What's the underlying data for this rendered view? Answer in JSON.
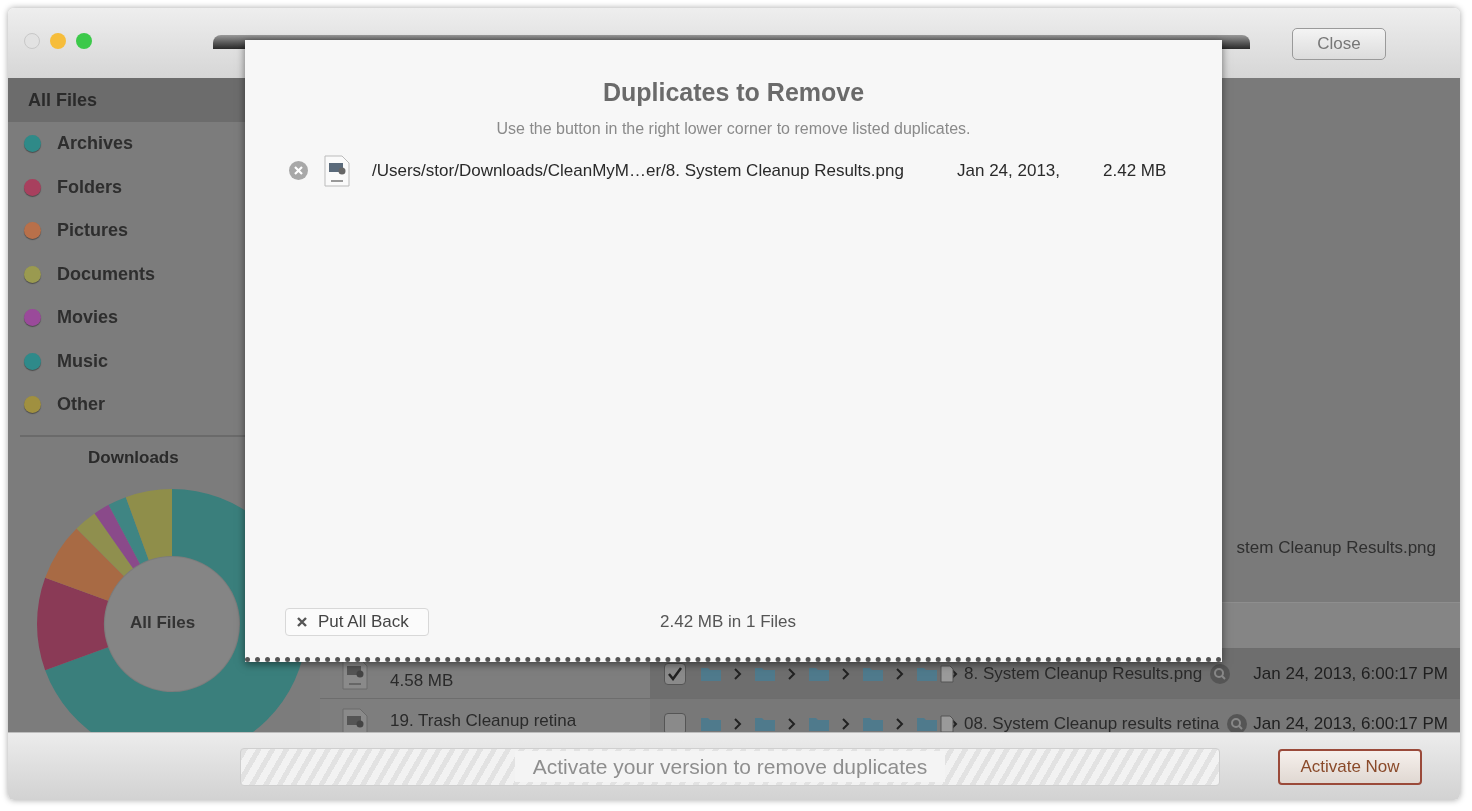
{
  "window": {
    "close_button": "Close"
  },
  "sidebar": {
    "header": "All Files",
    "items": [
      {
        "label": "Archives",
        "color": "#2f8a88"
      },
      {
        "label": "Folders",
        "color": "#a8405e"
      },
      {
        "label": "Pictures",
        "color": "#b8704a"
      },
      {
        "label": "Documents",
        "color": "#9a9a50"
      },
      {
        "label": "Movies",
        "color": "#9a4a9a"
      },
      {
        "label": "Music",
        "color": "#2f8a8a"
      },
      {
        "label": "Other",
        "color": "#a09040"
      }
    ],
    "chart_title": "Downloads",
    "chart_center": "All Files"
  },
  "background_list": {
    "detail_text": "stem Cleanup Results.png",
    "rows": [
      {
        "size": "4.58 MB",
        "checked": true,
        "file": "8. System Cleanup Results.png",
        "date": "Jan 24, 2013, 6:00:17 PM"
      },
      {
        "name": "19. Trash Cleanup retina",
        "checked": false,
        "file": "08. System Cleanup results retina",
        "date": "Jan 24, 2013, 6:00:17 PM"
      }
    ]
  },
  "sheet": {
    "title": "Duplicates to Remove",
    "subtitle": "Use the button in the right lower corner to remove listed duplicates.",
    "items": [
      {
        "path": "/Users/stor/Downloads/CleanMyM…er/8. System Cleanup Results.png",
        "date": "Jan 24, 2013,",
        "size": "2.42 MB"
      }
    ],
    "put_back_button": "Put All Back",
    "summary": "2.42 MB in 1 Files"
  },
  "bottom_bar": {
    "message": "Activate your version to remove duplicates",
    "activate_button": "Activate Now"
  }
}
